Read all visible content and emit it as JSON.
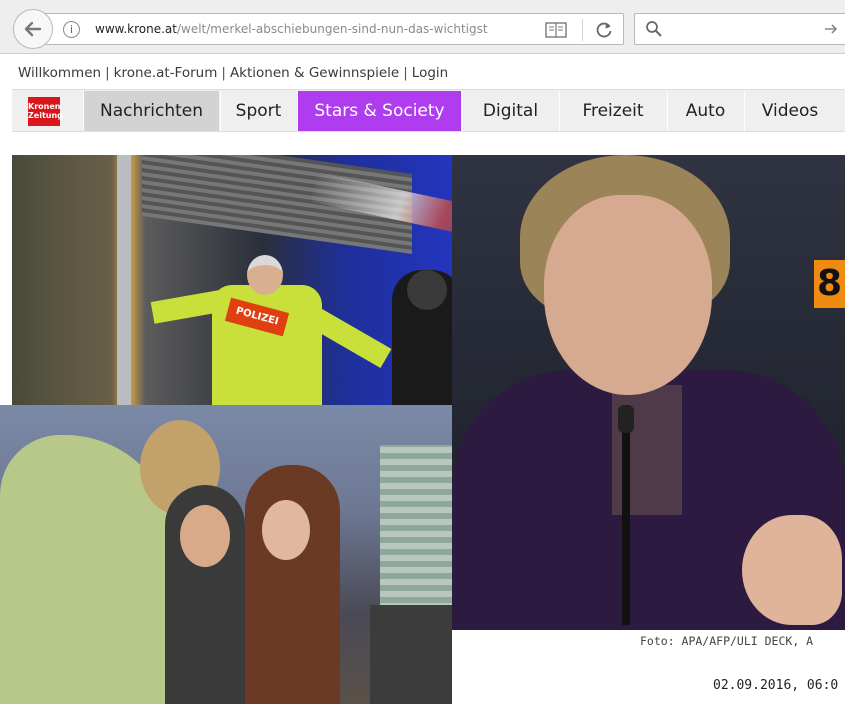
{
  "browser": {
    "url_host": "www.krone.at",
    "url_path": "/welt/merkel-abschiebungen-sind-nun-das-wichtigst",
    "info_glyph": "i",
    "icons": [
      "back-arrow-icon",
      "info-icon",
      "reader-view-icon",
      "reload-icon",
      "search-icon",
      "arrow-right-icon"
    ]
  },
  "topnav": {
    "items": [
      "Willkommen",
      "krone.at-Forum",
      "Aktionen & Gewinnspiele",
      "Login"
    ],
    "separator": "|"
  },
  "navbar": {
    "logo_text": "Kronen Zeitung",
    "tabs": [
      {
        "label": "Nachrichten",
        "active": true
      },
      {
        "label": "Sport"
      },
      {
        "label": "Stars & Society",
        "highlight": "#b03cf0"
      },
      {
        "label": "Digital"
      },
      {
        "label": "Freizeit"
      },
      {
        "label": "Auto"
      },
      {
        "label": "Videos"
      }
    ]
  },
  "photos": {
    "vest_text": "POLIZEI",
    "bus_number": "8"
  },
  "article": {
    "photo_credit": "Foto: APA/AFP/ULI DECK, A",
    "date": "02.09.2016, 06:0"
  },
  "colors": {
    "brand_red": "#d8161c",
    "stars_purple": "#b03cf0",
    "active_tab": "#d3d3d3"
  }
}
